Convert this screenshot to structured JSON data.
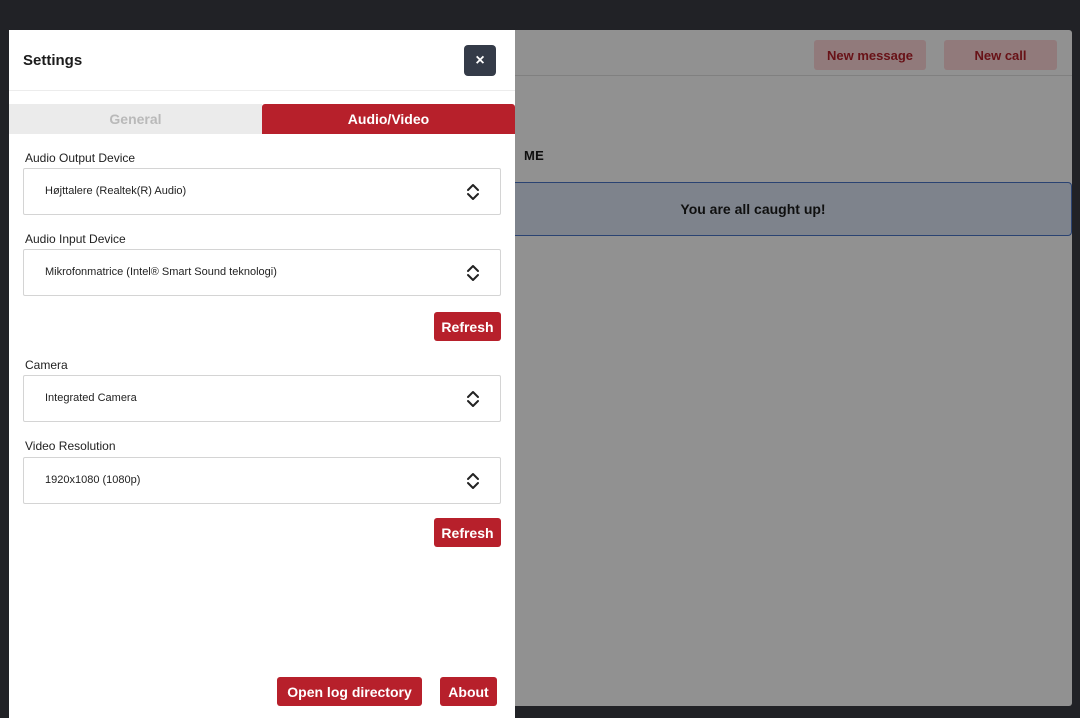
{
  "app": {
    "new_message_label": "New message",
    "new_call_label": "New call",
    "section_title": "ME",
    "caught_up_text": "You are all caught up!"
  },
  "settings": {
    "title": "Settings",
    "close_symbol": "×",
    "tabs": [
      {
        "label": "General",
        "active": false
      },
      {
        "label": "Audio/Video",
        "active": true
      }
    ],
    "audio_output": {
      "label": "Audio Output Device",
      "value": "Højttalere (Realtek(R) Audio)"
    },
    "audio_input": {
      "label": "Audio Input Device",
      "value": "Mikrofonmatrice (Intel® Smart Sound teknologi)"
    },
    "refresh_audio_label": "Refresh",
    "camera": {
      "label": "Camera",
      "value": "Integrated Camera"
    },
    "video_resolution": {
      "label": "Video Resolution",
      "value": "1920x1080 (1080p)"
    },
    "refresh_video_label": "Refresh",
    "open_log_label": "Open log directory",
    "about_label": "About"
  },
  "colors": {
    "accent_red": "#b7202b",
    "close_button_bg": "#343b48",
    "info_banner_border": "#4a76c9"
  },
  "icons": {
    "select_chevron": "chevron-up-down-icon",
    "close": "close-icon"
  }
}
